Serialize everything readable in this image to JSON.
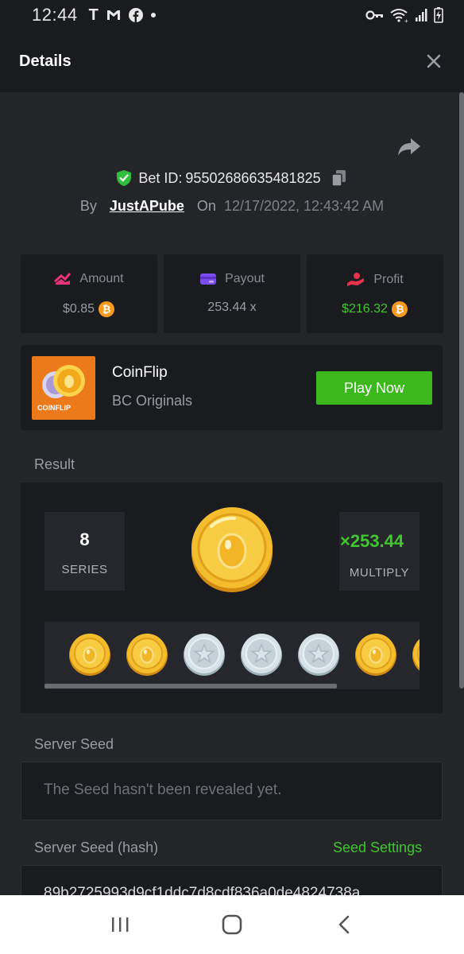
{
  "status_bar": {
    "time": "12:44",
    "notif_icons": [
      "t-icon",
      "gmail-icon",
      "facebook-icon",
      "dot-icon"
    ],
    "right_icons": [
      "vpn-key-icon",
      "wifi-icon",
      "signal-icon",
      "battery-icon"
    ]
  },
  "header": {
    "title": "Details",
    "close_icon": "close-icon"
  },
  "bet": {
    "id_prefix": "Bet ID:",
    "id": "95502686635481825",
    "by_label": "By",
    "user": "JustAPube",
    "on_label": "On",
    "date": "12/17/2022, 12:43:42 AM"
  },
  "stats": [
    {
      "label": "Amount",
      "value": "$0.85",
      "icon": "amount-icon",
      "coin": true
    },
    {
      "label": "Payout",
      "value": "253.44 x",
      "icon": "wallet-icon",
      "coin": false
    },
    {
      "label": "Profit",
      "value": "$216.32",
      "icon": "profit-icon",
      "coin": true
    }
  ],
  "game": {
    "name": "CoinFlip",
    "provider": "BC Originals",
    "thumb_text": "COINFLIP",
    "play_label": "Play Now"
  },
  "result": {
    "label": "Result",
    "series_value": "8",
    "series_label": "SERIES",
    "multiply_value": "×253.44",
    "multiply_label": "MULTIPLY",
    "coins": [
      "gold",
      "gold",
      "silver",
      "silver",
      "silver",
      "gold",
      "gold"
    ]
  },
  "server_seed": {
    "label": "Server Seed",
    "value": "The Seed hasn't been revealed yet."
  },
  "server_seed_hash": {
    "label": "Server Seed (hash)",
    "settings_label": "Seed Settings",
    "value": "89b2725993d9cf1ddc7d8cdf836a0de4824738a"
  },
  "colors": {
    "accent_green": "#3fc72d",
    "bg_dark": "#1a1b1f",
    "bg": "#232529",
    "coin_gold": "#f3b12a",
    "coin_silver": "#c9d6dc"
  },
  "nav": [
    "recents-icon",
    "home-icon",
    "back-icon"
  ]
}
